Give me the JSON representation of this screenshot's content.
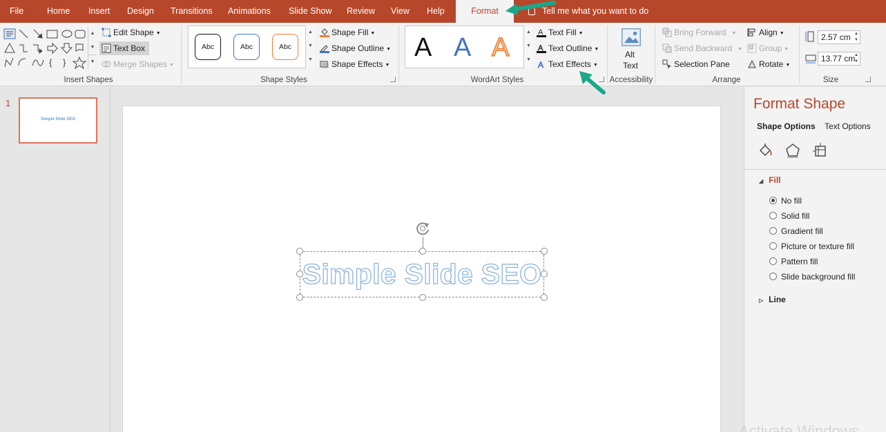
{
  "tabs": [
    {
      "label": "File"
    },
    {
      "label": "Home"
    },
    {
      "label": "Insert"
    },
    {
      "label": "Design"
    },
    {
      "label": "Transitions"
    },
    {
      "label": "Animations"
    },
    {
      "label": "Slide Show"
    },
    {
      "label": "Review"
    },
    {
      "label": "View"
    },
    {
      "label": "Help"
    },
    {
      "label": "Format"
    }
  ],
  "tell_me": "Tell me what you want to do",
  "ribbon": {
    "insert_shapes": {
      "label": "Insert Shapes",
      "edit_shape": "Edit Shape",
      "text_box": "Text Box",
      "merge_shapes": "Merge Shapes"
    },
    "shape_styles": {
      "label": "Shape Styles",
      "swatches": [
        "Abc",
        "Abc",
        "Abc"
      ],
      "shape_fill": "Shape Fill",
      "shape_outline": "Shape Outline",
      "shape_effects": "Shape Effects"
    },
    "wordart_styles": {
      "label": "WordArt Styles",
      "samples": [
        "A",
        "A",
        "A"
      ],
      "text_fill": "Text Fill",
      "text_outline": "Text Outline",
      "text_effects": "Text Effects"
    },
    "accessibility": {
      "label": "Accessibility",
      "alt_text_line1": "Alt",
      "alt_text_line2": "Text"
    },
    "arrange": {
      "label": "Arrange",
      "bring_forward": "Bring Forward",
      "send_backward": "Send Backward",
      "selection_pane": "Selection Pane",
      "align": "Align",
      "group": "Group",
      "rotate": "Rotate"
    },
    "size": {
      "label": "Size",
      "height": "2.57 cm",
      "width": "13.77 cm"
    }
  },
  "thumbnails": [
    {
      "number": "1",
      "text": "Simple Slide SEO"
    }
  ],
  "slide": {
    "text": "Simple Slide SEO"
  },
  "format_pane": {
    "title": "Format Shape",
    "tabs": [
      "Shape Options",
      "Text Options"
    ],
    "fill_heading": "Fill",
    "fill_options": [
      {
        "label": "No fill",
        "selected": true
      },
      {
        "label": "Solid fill",
        "selected": false
      },
      {
        "label": "Gradient fill",
        "selected": false
      },
      {
        "label": "Picture or texture fill",
        "selected": false
      },
      {
        "label": "Pattern fill",
        "selected": false
      },
      {
        "label": "Slide background fill",
        "selected": false
      }
    ],
    "line_heading": "Line"
  },
  "watermark": "Activate Windows",
  "colors": {
    "accent": "#b7472a",
    "annotation_arrow": "#1aa88a",
    "wordart_outline": "#8db3dc"
  }
}
